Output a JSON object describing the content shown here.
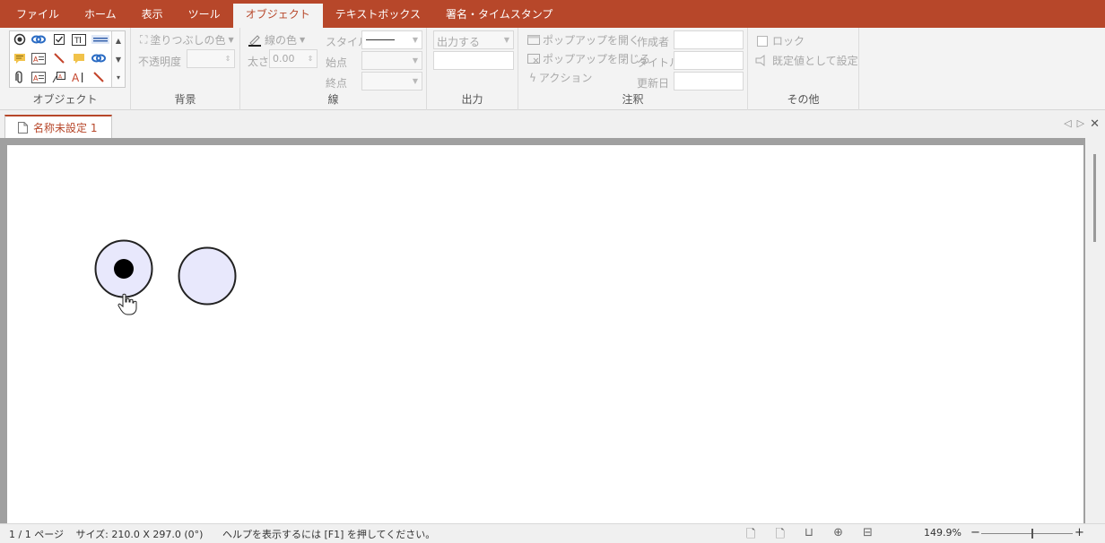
{
  "menubar": {
    "tabs": [
      "ファイル",
      "ホーム",
      "表示",
      "ツール",
      "オブジェクト",
      "テキストボックス",
      "署名・タイムスタンプ"
    ],
    "active_tab": "オブジェクト"
  },
  "ribbon": {
    "objects_label": "オブジェクト",
    "background": {
      "fill_color": "塗りつぶしの色",
      "opacity": "不透明度",
      "label": "背景"
    },
    "line": {
      "line_color": "線の色",
      "width_label": "太さ",
      "width_value": "0.00",
      "style_label": "スタイル",
      "start_label": "始点",
      "end_label": "終点",
      "label": "線"
    },
    "output": {
      "select_value": "出力する",
      "label": "出力"
    },
    "annotation": {
      "open_popup": "ポップアップを開く",
      "close_popup": "ポップアップを閉じる",
      "action": "アクション",
      "author": "作成者",
      "title": "タイトル",
      "modified": "更新日",
      "label": "注釈"
    },
    "other": {
      "lock": "ロック",
      "set_default": "既定値として設定",
      "label": "その他"
    }
  },
  "document": {
    "tab_title": "名称未設定 1"
  },
  "statusbar": {
    "page": "1 / 1 ページ",
    "size": "サイズ: 210.0 X 297.0 (0°)",
    "help": "ヘルプを表示するには [F1] を押してください。",
    "zoom": "149.9%",
    "zoom_minus": "−",
    "zoom_plus": "+"
  },
  "colors": {
    "accent": "#b7472a",
    "circle_fill": "#e8e8fc",
    "circle_stroke": "#222222"
  }
}
